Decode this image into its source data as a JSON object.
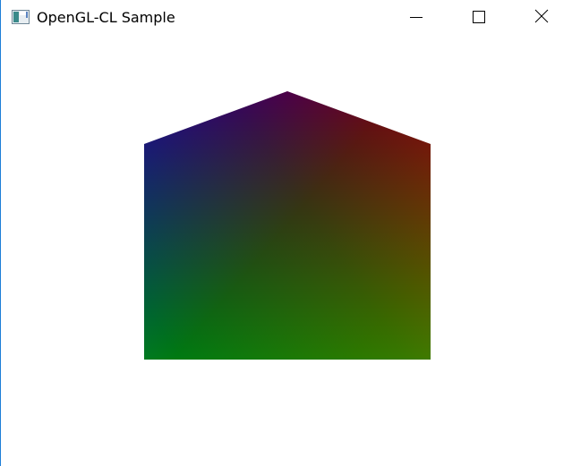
{
  "window": {
    "title": "OpenGL-CL Sample",
    "accent_border_color": "#1e7fd8",
    "icons": {
      "app": "app-window-icon",
      "minimize": "minimize-icon",
      "maximize": "maximize-icon",
      "close": "close-icon"
    }
  },
  "scene": {
    "description_colors": {
      "top_peak": "#7a0000",
      "top_left": "#00007a",
      "top_right": "#7a0000",
      "bottom": "#007a00"
    }
  }
}
